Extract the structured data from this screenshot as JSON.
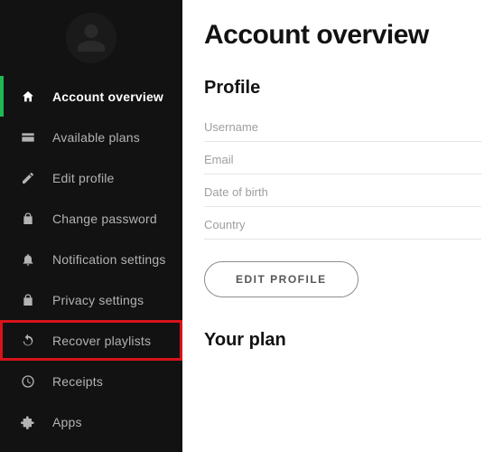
{
  "sidebar": {
    "items": [
      {
        "label": "Account overview"
      },
      {
        "label": "Available plans"
      },
      {
        "label": "Edit profile"
      },
      {
        "label": "Change password"
      },
      {
        "label": "Notification settings"
      },
      {
        "label": "Privacy settings"
      },
      {
        "label": "Recover playlists"
      },
      {
        "label": "Receipts"
      },
      {
        "label": "Apps"
      }
    ]
  },
  "main": {
    "title": "Account overview",
    "profile_heading": "Profile",
    "fields": {
      "username": "Username",
      "email": "Email",
      "dob": "Date of birth",
      "country": "Country"
    },
    "edit_button": "EDIT PROFILE",
    "plan_heading": "Your plan"
  }
}
